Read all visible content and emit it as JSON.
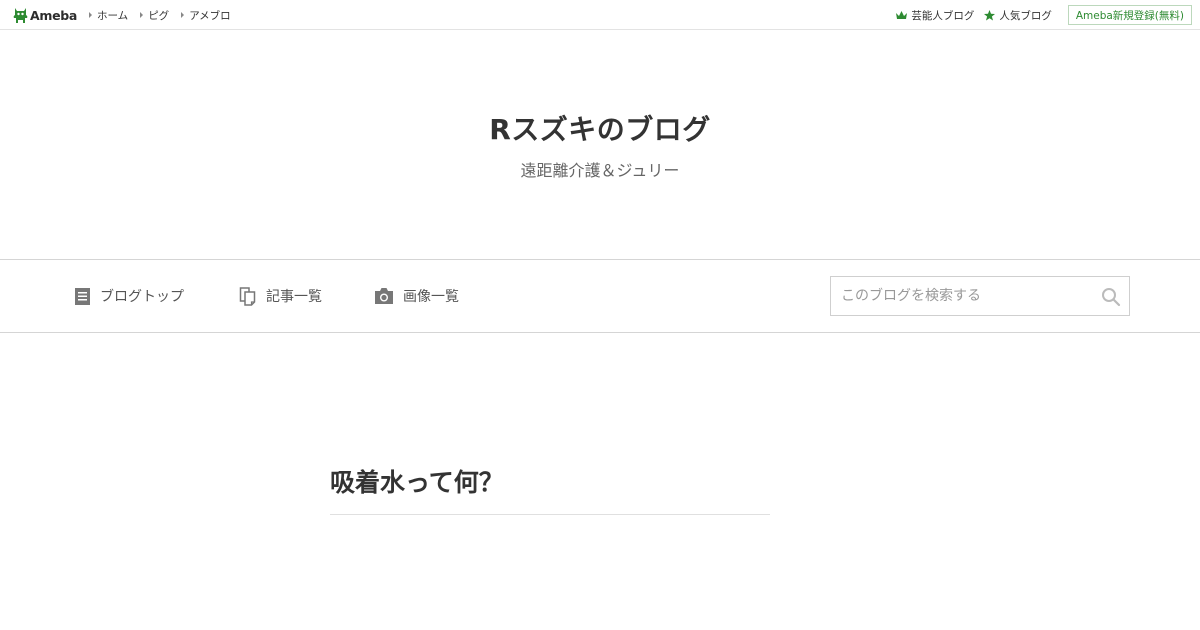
{
  "topbar": {
    "logo_text": "Ameba",
    "nav": [
      {
        "label": "ホーム"
      },
      {
        "label": "ピグ"
      },
      {
        "label": "アメブロ"
      }
    ],
    "links": {
      "celebrity_blog": "芸能人ブログ",
      "popular_blog": "人気ブログ",
      "signup": "Ameba新規登録(無料)"
    }
  },
  "header": {
    "title": "Rスズキのブログ",
    "description": "遠距離介護＆ジュリー"
  },
  "blog_nav": {
    "top": "ブログトップ",
    "entries": "記事一覧",
    "images": "画像一覧"
  },
  "search": {
    "placeholder": "このブログを検索する",
    "value": ""
  },
  "article": {
    "title": "吸着水って何？"
  },
  "colors": {
    "brand_green": "#2e8b32",
    "text": "#333333",
    "border": "#d5d5d5"
  }
}
